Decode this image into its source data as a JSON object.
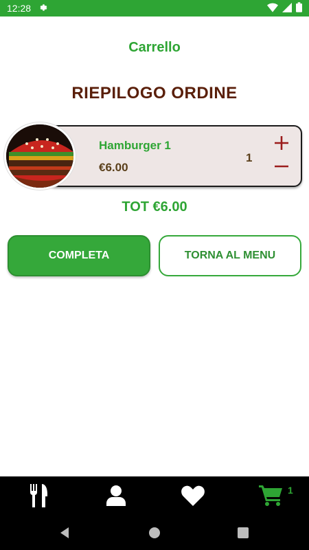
{
  "status_bar": {
    "time": "12:28"
  },
  "header": {
    "title": "Carrello"
  },
  "summary": {
    "title": "RIEPILOGO ORDINE"
  },
  "cart": {
    "items": [
      {
        "name": "Hamburger 1",
        "price": "€6.00",
        "quantity": "1",
        "image": "hamburger-image"
      }
    ],
    "total": "TOT €6.00"
  },
  "actions": {
    "complete_label": "COMPLETA",
    "back_label": "TORNA AL MENU"
  },
  "bottom_nav": {
    "items": [
      "menu-icon",
      "user-icon",
      "heart-icon",
      "cart-icon"
    ],
    "cart_count": "1",
    "active": "cart"
  },
  "colors": {
    "accent": "#2ea534",
    "heading": "#5a1f0a",
    "price": "#5a3f1a",
    "control": "#9b1c1c"
  }
}
